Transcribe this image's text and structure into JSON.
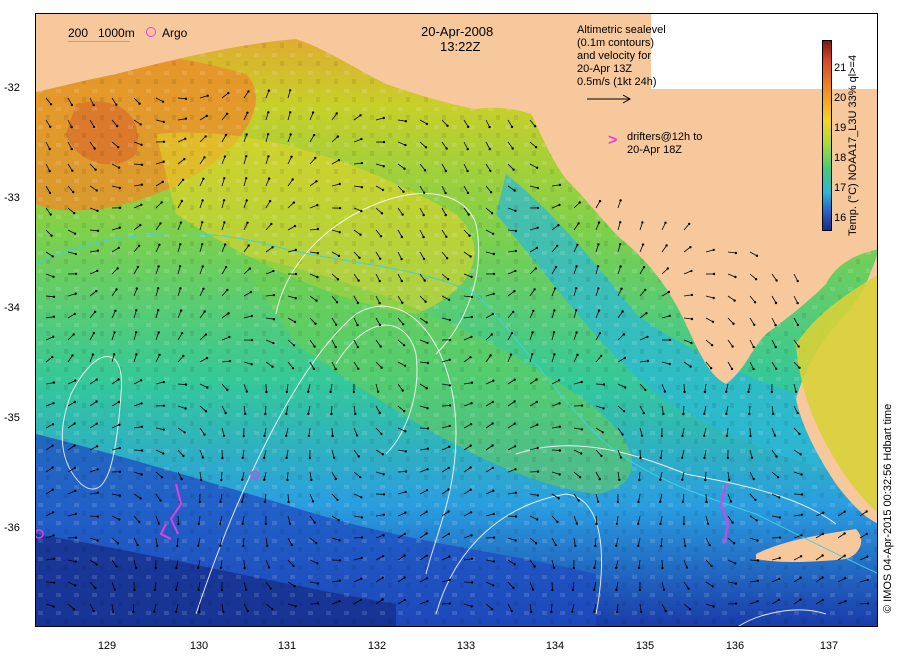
{
  "map": {
    "date": "20-Apr-2008",
    "time": "13:22Z",
    "scale_bar_label": "200",
    "depth_label": "1000m",
    "argo_label": "Argo",
    "info_lines": [
      "Altimetric sealevel",
      "(0.1m contours)",
      "and velocity for",
      "20-Apr 13Z",
      "0.5m/s (1kt 24h)"
    ],
    "drifter_symbol": ">",
    "drifter_lines": [
      "drifters@12h to",
      "20-Apr 18Z"
    ],
    "lat_labels": [
      "-32",
      "-33",
      "-34",
      "-35",
      "-36"
    ],
    "lon_labels": [
      "129",
      "130",
      "131",
      "132",
      "133",
      "134",
      "135",
      "136",
      "137"
    ],
    "colorbar_title": "Temp. (°C) NOAA17_L3U 33% ql>=4",
    "colorbar_ticks": [
      "21",
      "20",
      "19",
      "18",
      "17",
      "16"
    ],
    "credit": "© IMOS 04-Apr-2015 00:32:56 Hdbart time",
    "colors": {
      "land": "#f7c89b",
      "warm": "#e08a1e",
      "mid": "#9ad74a",
      "cool": "#2bb8d8",
      "cold": "#1a3fb0",
      "drifter": "#e040e0",
      "contour": "#ffffff"
    }
  }
}
